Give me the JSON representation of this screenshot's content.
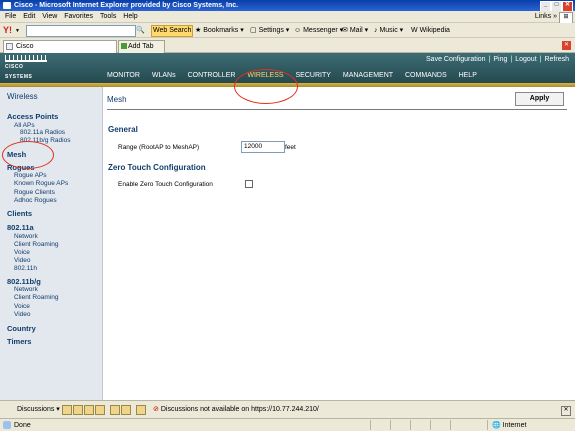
{
  "window": {
    "title": "Cisco - Microsoft Internet Explorer provided by Cisco Systems, Inc."
  },
  "menu": {
    "items": [
      "File",
      "Edit",
      "View",
      "Favorites",
      "Tools",
      "Help"
    ],
    "links_label": "Links"
  },
  "toolbar": {
    "yahoo_label": "Y!",
    "web_search": "Web Search",
    "bookmarks": "Bookmarks",
    "settings": "Settings",
    "messenger": "Messenger",
    "mail": "Mail",
    "music": "Music",
    "wikipedia": "Wikipedia"
  },
  "tabs": {
    "current": "Cisco",
    "add": "Add Tab"
  },
  "cisco": {
    "logo": "CISCO SYSTEMS",
    "top_links": [
      "Save Configuration",
      "Ping",
      "Logout",
      "Refresh"
    ],
    "nav": [
      "MONITOR",
      "WLANs",
      "CONTROLLER",
      "WIRELESS",
      "SECURITY",
      "MANAGEMENT",
      "COMMANDS",
      "HELP"
    ],
    "active_nav": "WIRELESS"
  },
  "sidebar": {
    "title": "Wireless",
    "access_points": "Access Points",
    "ap_items": [
      "All APs",
      "802.11a Radios",
      "802.11b/g Radios"
    ],
    "mesh": "Mesh",
    "rogues": "Rogues",
    "rogue_items": [
      "Rogue APs",
      "Known Rogue APs",
      "Rogue Clients",
      "Adhoc Rogues"
    ],
    "clients": "Clients",
    "a_section": "802.11a",
    "a_items": [
      "Network",
      "Client Roaming",
      "Voice",
      "Video",
      "802.11h"
    ],
    "bg_section": "802.11b/g",
    "bg_items": [
      "Network",
      "Client Roaming",
      "Voice",
      "Video"
    ],
    "country": "Country",
    "timers": "Timers"
  },
  "main": {
    "title": "Mesh",
    "apply": "Apply",
    "general": "General",
    "range_label": "Range (RootAP to MeshAP)",
    "range_value": "12000",
    "range_unit": "feet",
    "ztc_title": "Zero Touch Configuration",
    "ztc_label": "Enable Zero Touch Configuration",
    "ztc_enabled": false
  },
  "discussions": {
    "label": "Discussions",
    "message": "Discussions not available on https://10.77.244.210/"
  },
  "status": {
    "left": "Done",
    "zone": "Internet"
  },
  "colors": {
    "accent": "#e2301c",
    "nav_active": "#ffd46a",
    "header": "#2f5a61",
    "sidebar_bg": "#e3e7ee"
  }
}
